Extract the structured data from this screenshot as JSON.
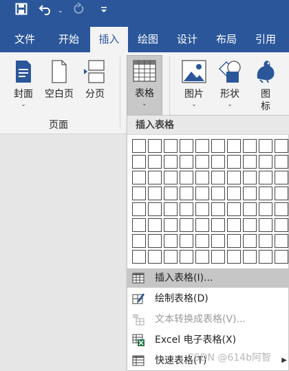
{
  "tabs": [
    {
      "label": "文件"
    },
    {
      "label": "开始"
    },
    {
      "label": "插入"
    },
    {
      "label": "绘图"
    },
    {
      "label": "设计"
    },
    {
      "label": "布局"
    },
    {
      "label": "引用"
    }
  ],
  "ribbon": {
    "pages_group": {
      "cover": "封面",
      "blank_page": "空白页",
      "page_break": "分页",
      "group_label": "页面"
    },
    "table": "表格",
    "picture": "图片",
    "shapes": "形状",
    "icons_line1": "图",
    "icons_line2": "标"
  },
  "dropdown": {
    "header": "插入表格",
    "grid_rows": 8,
    "grid_cols": 10,
    "items": [
      {
        "label": "插入表格(I)..."
      },
      {
        "label": "绘制表格(D)"
      },
      {
        "label": "文本转换成表格(V)..."
      },
      {
        "label": "Excel 电子表格(X)"
      },
      {
        "label": "快速表格(T)"
      }
    ]
  },
  "watermark": "CSDN @614b阿智",
  "colors": {
    "brand": "#2b579a",
    "excel": "#217346"
  }
}
